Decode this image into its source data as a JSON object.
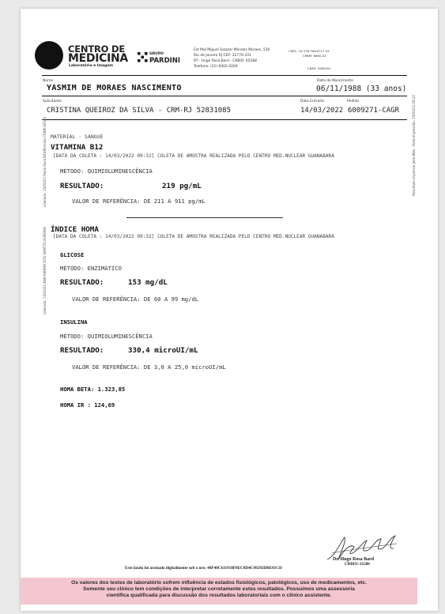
{
  "header": {
    "logo_line1": "CENTRO DE",
    "logo_line2": "MEDICINA",
    "logo_line3": "Laboratório e Imagem",
    "pardini_line1": "GRUPO",
    "pardini_line2": "PARDINI",
    "address_lines": [
      "Est Mal Miguel Salazar Mendes Moraes, 516",
      "Rio de Janeiro RJ CEP: 22770-331",
      "RT - Hugo Rosa Bard - CRBIO: 65288",
      "Telefone: (21) 6002-0200"
    ],
    "cnpj": "CNPJ.: 19.378.769/0117-34",
    "crbm": "CRBM: 6665-02",
    "cnes": "CNES: 5560051"
  },
  "patient": {
    "name_label": "Nome",
    "name": "YASMIM DE MORAES NASCIMENTO",
    "dob_label": "Data de Nascimento",
    "dob": "06/11/1988 (33 anos)",
    "requester_label": "Solicitante",
    "requester": "CRISTINA QUEIROZ DA SILVA - CRM-RJ 52831085",
    "entry_label": "Data Entrada",
    "entry_date": "14/03/2022",
    "order_label": "Pedido",
    "order": "6009271-CAGR"
  },
  "side_texts": {
    "left1": "Liberado: 15/03/22 Paulo Rosa Bitt/Almeida-CRBM 66549",
    "left2": "Liberado: 15/03/22 ANA KARINA DOS SANTOS ALMEIDA",
    "right": "Resultado impresso pela Web - Data Impressão: 15/03/22 09:22"
  },
  "vitb12": {
    "material": "MATERIAL - SANGUE",
    "title": "VITAMINA B12",
    "collection": "[DATA DA COLETA : 14/03/2022  09:32] COLETA DE AMOSTRA REALIZADA PELO CENTRO MED.NUCLEAR GUANABARA",
    "method": "MÉTODO: QUIMIOLUMINESCÊNCIA",
    "result_label": "RESULTADO:",
    "result_value": "219 pg/mL",
    "reference": "VALOR DE REFERÊNCIA: DE 211 A 911 pg/mL"
  },
  "homa": {
    "title": "ÍNDICE HOMA",
    "collection": "[DATA DA COLETA : 14/03/2022  09:32] COLETA DE AMOSTRA REALIZADA PELO CENTRO MED.NUCLEAR GUANABARA",
    "glicose_title": "GLICOSE",
    "glicose_method": "MÉTODO: ENZIMÁTICO",
    "glicose_result_label": "RESULTADO:",
    "glicose_result_value": "153 mg/dL",
    "glicose_reference": "VALOR DE REFERÊNCIA: DE 60 A 99 mg/dL",
    "insulina_title": "INSULINA",
    "insulina_method": "MÉTODO: QUIMIOLUMINESCÊNCIA",
    "insulina_result_label": "RESULTADO:",
    "insulina_result_value": "330,4 microUI/mL",
    "insulina_reference": "VALOR DE REFERÊNCIA: DE 3,0 A 25,0 microUI/mL",
    "beta": "HOMA BETA: 1.323,85",
    "ir": "HOMA IR  : 124,69"
  },
  "signature": {
    "name": "Dr. Hugo Rosa Bard",
    "crbio": "CRBIO: 65288"
  },
  "footer": {
    "digital_sign": "Este laudo foi assinado digitalmente sob o nro: 48F40C611918F8EC8D4C09292DBE81CD",
    "disclaimer_lines": [
      "Os valores dos testes de laboratório sofrem influência de estados fisiológicos, patológicos, uso de medicamentos, etc.",
      "Somente seu clínico tem condições de interpretar corretamente estes resultados.  Possuímos  uma  assessoria",
      "científica qualificada para discussão dos resultados laboratoriais com o clínico assistente."
    ]
  }
}
